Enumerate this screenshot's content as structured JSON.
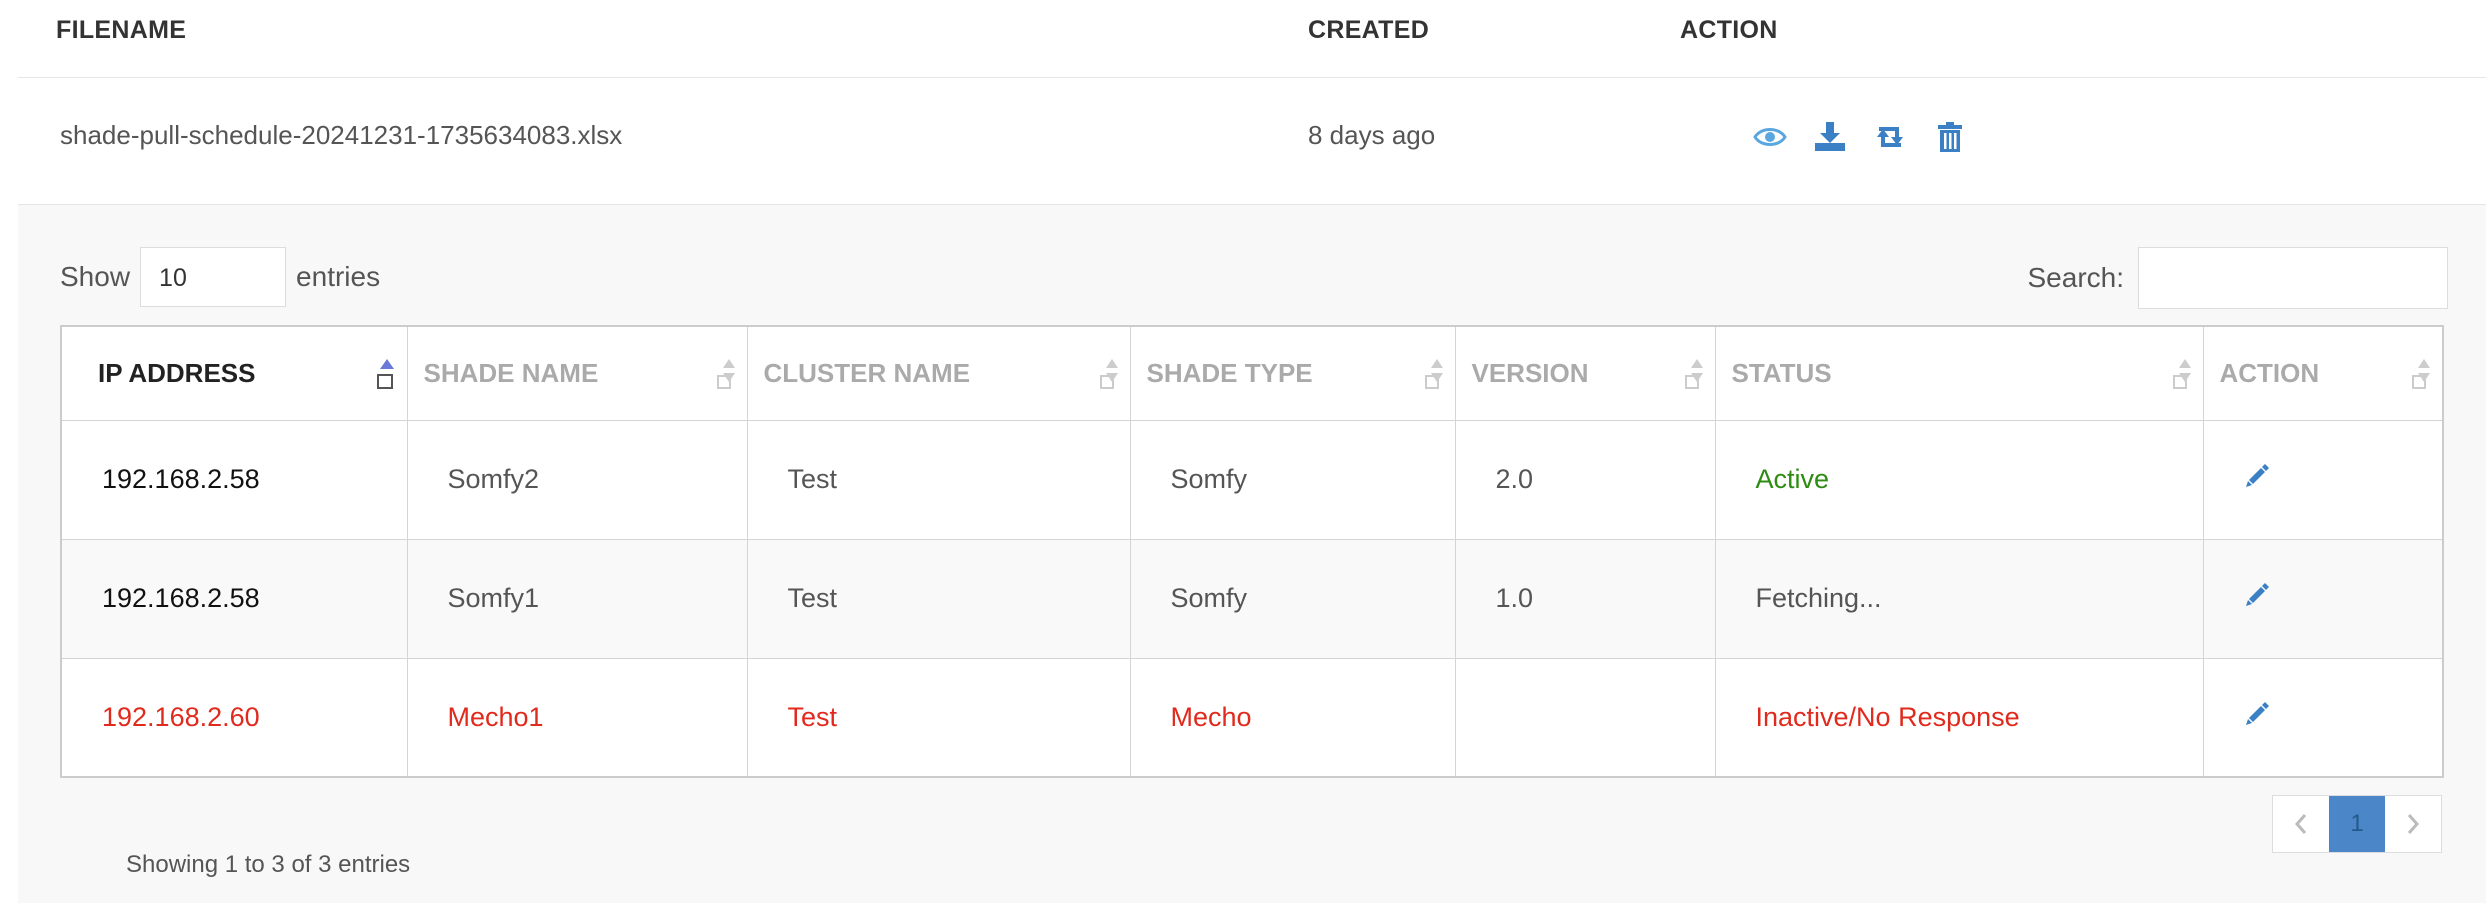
{
  "files": {
    "headers": {
      "filename": "FILENAME",
      "created": "CREATED",
      "action": "ACTION"
    },
    "row": {
      "filename": "shade-pull-schedule-20241231-1735634083.xlsx",
      "created": "8 days ago",
      "action_icons": [
        "eye-icon",
        "download-icon",
        "retweet-icon",
        "trash-icon"
      ]
    }
  },
  "table_controls": {
    "show_label": "Show",
    "entries_value": "10",
    "entries_label": "entries",
    "search_label": "Search:",
    "search_value": ""
  },
  "shades_table": {
    "columns": [
      "IP ADDRESS",
      "SHADE NAME",
      "CLUSTER NAME",
      "SHADE TYPE",
      "VERSION",
      "STATUS",
      "ACTION"
    ],
    "rows": [
      {
        "ip": "192.168.2.58",
        "name": "Somfy2",
        "cluster": "Test",
        "type": "Somfy",
        "version": "2.0",
        "status": "Active"
      },
      {
        "ip": "192.168.2.58",
        "name": "Somfy1",
        "cluster": "Test",
        "type": "Somfy",
        "version": "1.0",
        "status": "Fetching..."
      },
      {
        "ip": "192.168.2.60",
        "name": "Mecho1",
        "cluster": "Test",
        "type": "Mecho",
        "version": "",
        "status": "Inactive/No Response"
      }
    ]
  },
  "pagination": {
    "info": "Showing 1 to 3 of 3 entries",
    "current_page": "1"
  },
  "colors": {
    "accent": "#4a86c8",
    "active_status": "#2e8c12",
    "error_row": "#e02a1d",
    "icon_blue": "#3b7fc4"
  }
}
